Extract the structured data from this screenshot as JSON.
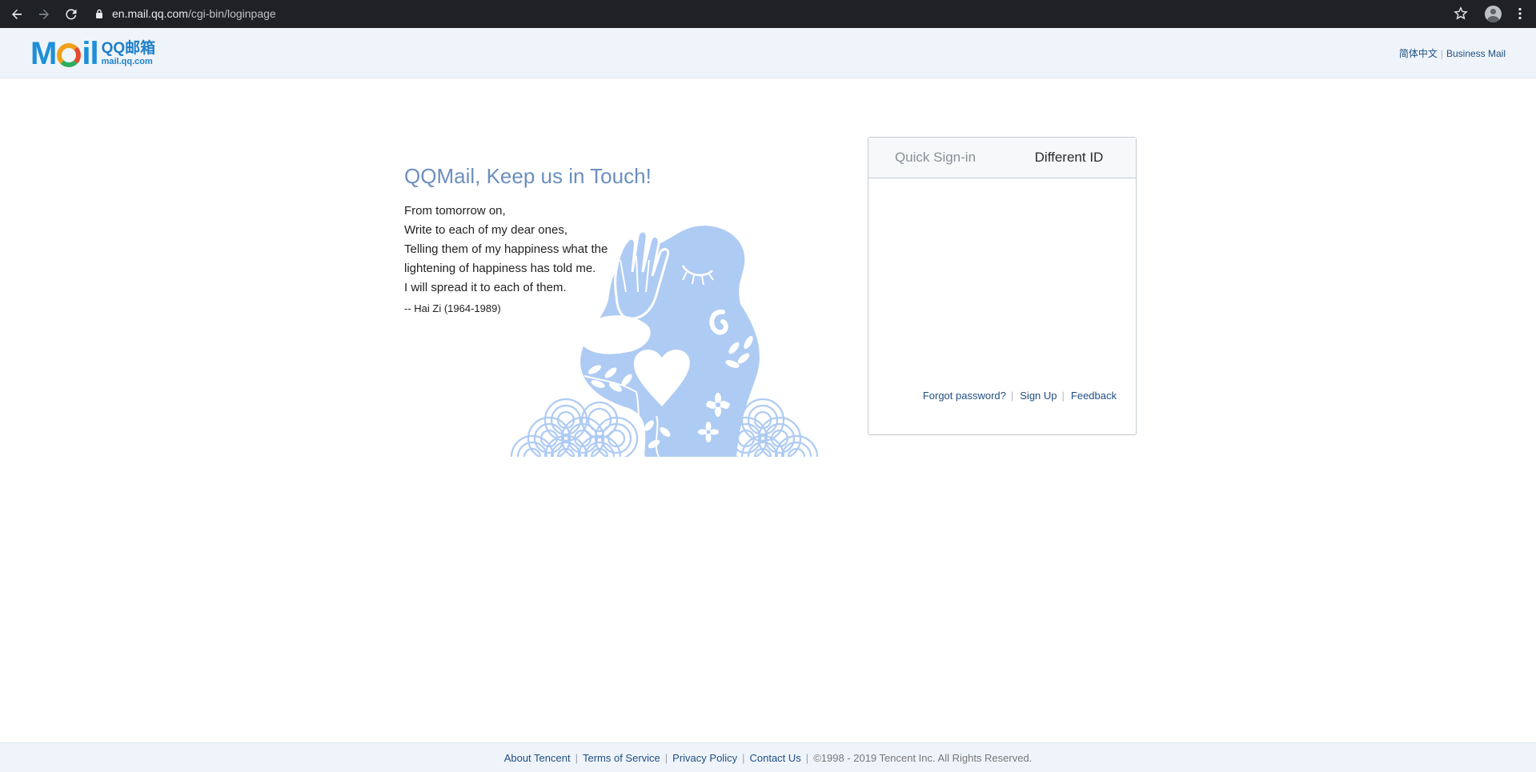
{
  "browser": {
    "url_host": "en.mail.qq.com",
    "url_path": "/cgi-bin/loginpage",
    "back_icon": "arrow-left-icon",
    "forward_icon": "arrow-right-icon",
    "reload_icon": "reload-icon",
    "lock_icon": "lock-icon",
    "bookmark_icon": "star-icon",
    "profile_icon": "avatar-icon",
    "menu_icon": "kebab-menu-icon"
  },
  "header": {
    "logo_word_m": "M",
    "logo_word_il": "il",
    "logo_cn": "QQ邮箱",
    "logo_sub": "mail.qq.com",
    "lang_label": "简体中文",
    "business_mail": "Business Mail"
  },
  "promo": {
    "title": "QQMail, Keep us in Touch!",
    "poem_lines": [
      "From tomorrow on,",
      "Write to each of my dear ones,",
      "Telling them of my happiness what the",
      "lightening of happiness has told me.",
      "I will spread it to each of them."
    ],
    "author": "-- Hai Zi (1964-1989)"
  },
  "login": {
    "tab_quick": "Quick Sign-in",
    "tab_different": "Different ID",
    "forgot_password": "Forgot password?",
    "sign_up": "Sign Up",
    "feedback": "Feedback"
  },
  "footer": {
    "about": "About Tencent",
    "terms": "Terms of Service",
    "privacy": "Privacy Policy",
    "contact": "Contact Us",
    "copyright": "©1998 - 2019 Tencent Inc. All Rights Reserved."
  },
  "colors": {
    "header_bg": "#eff4fa",
    "link": "#1f4f82",
    "title": "#6c8fbf",
    "illustration": "#aecbf3"
  }
}
